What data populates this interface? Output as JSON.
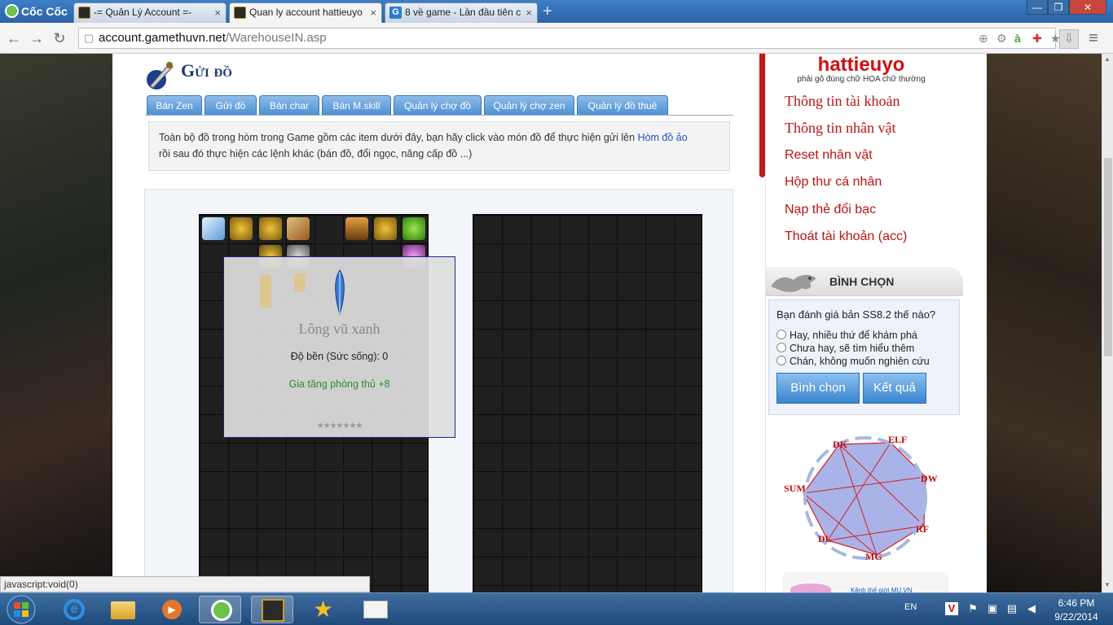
{
  "browser": {
    "logo": "Cốc Cốc",
    "tabs": [
      {
        "title": "-= Quản Lý Account =-"
      },
      {
        "title": "Quan ly account hattieuyo"
      },
      {
        "title": "8 về game - Lần đầu tiên c"
      }
    ],
    "url_domain": "account.gamethuvn.net",
    "url_path": "/WarehouseIN.asp",
    "status": "javascript:void(0)"
  },
  "page": {
    "title": "Gửi đồ",
    "tabs": [
      "Bán Zen",
      "Gửi đồ",
      "Bán char",
      "Bán M.skill",
      "Quản lý chợ đồ",
      "Quản lý chợ zen",
      "Quản lý đồ thuê"
    ],
    "notice_text": "Toàn bộ đồ trong hòm trong Game gồm các item dưới đây, bạn hãy click vào món đồ để thực hiện gửi lên",
    "notice_link": "Hòm đồ ảo",
    "notice_tail": "rồi sau đó thực hiện các lệnh khác (bán đồ, đổi ngọc, nâng cấp đồ ...)",
    "tooltip": {
      "name": "Lông vũ xanh",
      "durability": "Độ bền (Sức sống): 0",
      "bonus": "Gia tăng phòng thủ +8",
      "stars": "★★★★★★★"
    }
  },
  "sidebar": {
    "username": "hattieuyo",
    "hint": "phải gõ đúng chữ HOA chữ thường",
    "menu": [
      {
        "label": "Thông tin tài khoản"
      },
      {
        "label": "Thông tin nhân vật"
      },
      {
        "label": "Reset nhân vật"
      },
      {
        "label": "Hộp thư cá nhân"
      },
      {
        "label": "Nạp thẻ đổi bạc"
      },
      {
        "label": "Thoát tài khoản (acc)"
      }
    ],
    "vote": {
      "title": "BÌNH CHỌN",
      "question": "Bạn đánh giá bản SS8.2 thế nào?",
      "options": [
        "Hay, nhiều thứ để khám phá",
        "Chưa hay, sẽ tìm hiểu thêm",
        "Chán, không muốn nghiên cứu"
      ],
      "vote_button": "Bình chọn",
      "result_button": "Kết quả"
    },
    "diagram_labels": [
      "DK",
      "ELF",
      "DW",
      "RF",
      "MG",
      "DL",
      "SUM"
    ],
    "bottom_ad": "Kênh thế giới MU.VN"
  },
  "taskbar": {
    "language": "EN",
    "time": "6:46 PM",
    "date": "9/22/2014"
  },
  "colors": {
    "accent_red": "#c21a1a",
    "tab_blue": "#4a8fd3",
    "link_blue": "#1a57c7",
    "bonus_green": "#2e8b2e"
  }
}
